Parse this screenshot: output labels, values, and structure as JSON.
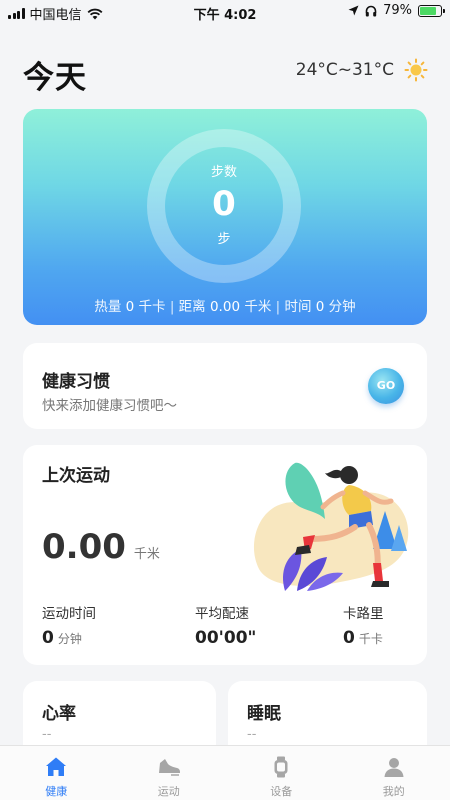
{
  "status_bar": {
    "carrier": "中国电信",
    "time": "下午 4:02",
    "battery": "79%",
    "battery_level": 0.79
  },
  "header": {
    "title": "今天",
    "temperature": "24°C~31°C",
    "weather_icon": "sun-icon"
  },
  "steps": {
    "label": "步数",
    "value": "0",
    "unit": "步",
    "heat_label": "热量",
    "heat_value": "0",
    "heat_unit": "千卡",
    "distance_label": "距离",
    "distance_value": "0.00",
    "distance_unit": "千米",
    "time_label": "时间",
    "time_value": "0",
    "time_unit": "分钟",
    "separator": "|"
  },
  "habit": {
    "title": "健康习惯",
    "subtitle": "快来添加健康习惯吧～",
    "go_label": "GO"
  },
  "last_sport": {
    "title": "上次运动",
    "distance_value": "0.00",
    "distance_unit": "千米",
    "stats": [
      {
        "label": "运动时间",
        "value": "0",
        "unit": "分钟"
      },
      {
        "label": "平均配速",
        "value": "00'00\"",
        "unit": ""
      },
      {
        "label": "卡路里",
        "value": "0",
        "unit": "千卡"
      }
    ]
  },
  "heart_rate": {
    "title": "心率",
    "value": "--"
  },
  "sleep": {
    "title": "睡眠",
    "value": "--"
  },
  "tabs": [
    {
      "label": "健康",
      "icon": "home-icon",
      "active": true
    },
    {
      "label": "运动",
      "icon": "shoe-icon",
      "active": false
    },
    {
      "label": "设备",
      "icon": "watch-icon",
      "active": false
    },
    {
      "label": "我的",
      "icon": "person-icon",
      "active": false
    }
  ],
  "colors": {
    "accent": "#2f7df6",
    "card_gradient_top": "#8ff0d9",
    "card_gradient_bottom": "#4390f2"
  }
}
